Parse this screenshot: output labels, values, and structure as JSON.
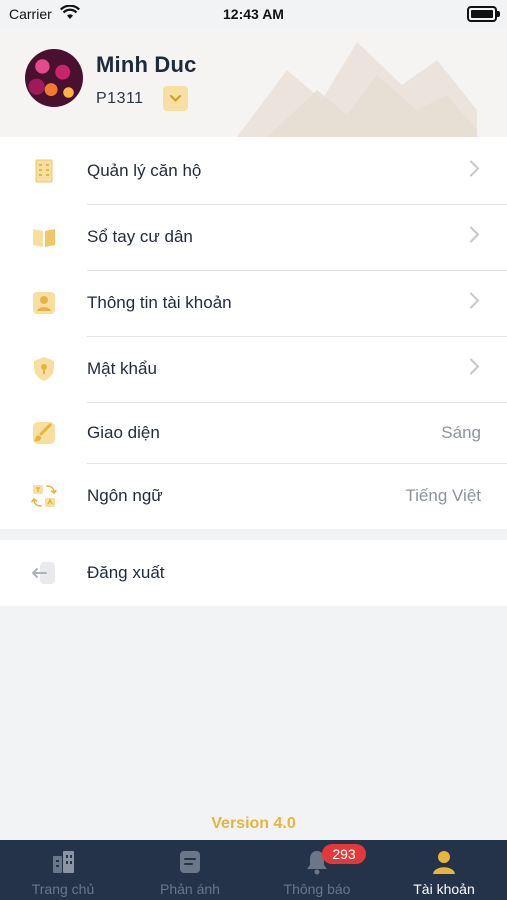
{
  "status_bar": {
    "carrier": "Carrier",
    "time": "12:43 AM"
  },
  "profile": {
    "name": "Minh Duc",
    "unit": "P1311"
  },
  "menu": {
    "items": [
      {
        "label": "Quản lý căn hộ",
        "icon": "building-icon"
      },
      {
        "label": "Sổ tay cư dân",
        "icon": "book-icon"
      },
      {
        "label": "Thông tin tài khoản",
        "icon": "user-card-icon"
      },
      {
        "label": "Mật khẩu",
        "icon": "shield-lock-icon"
      },
      {
        "label": "Giao diện",
        "value": "Sáng",
        "icon": "paint-brush-icon"
      },
      {
        "label": "Ngôn ngữ",
        "value": "Tiếng Việt",
        "icon": "translate-icon"
      }
    ]
  },
  "logout": {
    "label": "Đăng xuất",
    "icon": "logout-icon"
  },
  "version": "Version 4.0",
  "tabbar": {
    "tabs": [
      {
        "label": "Trang chủ",
        "icon": "home-building-icon"
      },
      {
        "label": "Phản ánh",
        "icon": "feedback-icon"
      },
      {
        "label": "Thông báo",
        "icon": "bell-icon",
        "badge": "293"
      },
      {
        "label": "Tài khoản",
        "icon": "account-icon",
        "active": true
      }
    ]
  },
  "colors": {
    "accent": "#e8b53c",
    "icon_fill": "#f6dfa0",
    "tabbar_bg": "#24324a",
    "badge": "#e23a3a"
  }
}
